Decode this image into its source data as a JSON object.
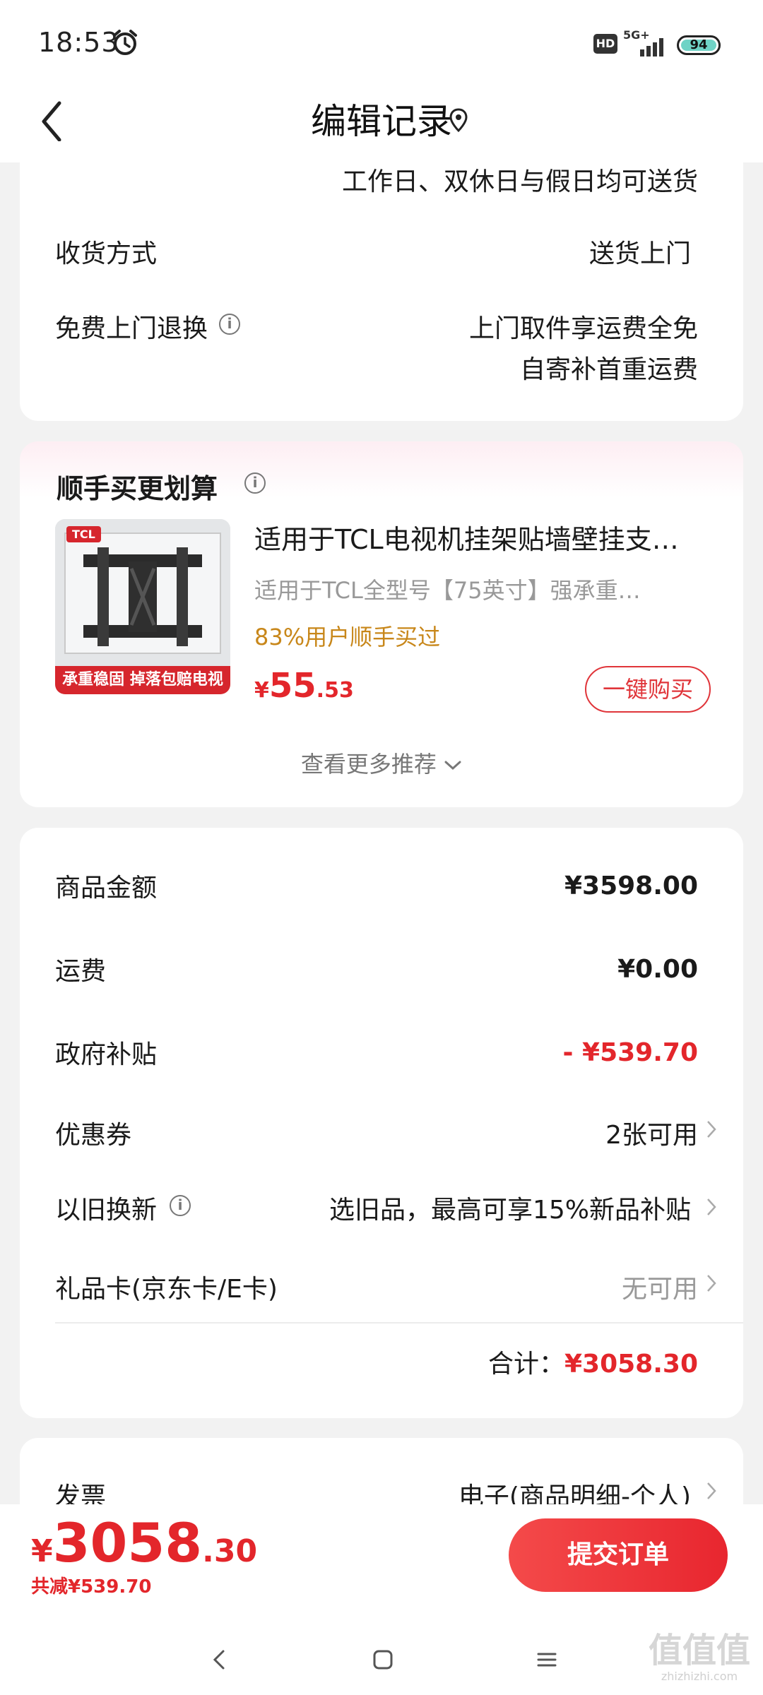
{
  "status": {
    "time": "18:53",
    "hd": "HD",
    "network": "5G+",
    "battery": "94"
  },
  "header": {
    "title": "编辑记录"
  },
  "delivery": {
    "delivery_days": "工作日、双休日与假日均可送货",
    "method_label": "收货方式",
    "method_value": "送货上门",
    "return_label": "免费上门退换",
    "return_value_1": "上门取件享运费全免",
    "return_value_2": "自寄补首重运费"
  },
  "recommend": {
    "title": "顺手买更划算",
    "product_title": "适用于TCL电视机挂架贴墙壁挂支…",
    "product_subtitle": "适用于TCL全型号【75英寸】强承重…",
    "social_proof": "83%用户顺手买过",
    "price_symbol": "¥",
    "price_int": "55",
    "price_dec": ".53",
    "buy_button": "一键购买",
    "more": "查看更多推荐",
    "thumb_tag": "TCL",
    "thumb_label": "承重稳固 掉落包赔电视"
  },
  "summary": {
    "goods_label": "商品金额",
    "goods_value": "¥3598.00",
    "shipping_label": "运费",
    "shipping_value": "¥0.00",
    "subsidy_label": "政府补贴",
    "subsidy_value": "- ¥539.70",
    "coupon_label": "优惠券",
    "coupon_value": "2张可用",
    "tradein_label": "以旧换新",
    "tradein_value": "选旧品，最高可享15%新品补贴",
    "giftcard_label": "礼品卡(京东卡/E卡)",
    "giftcard_value": "无可用",
    "total_label": "合计：",
    "total_value": "¥3058.30"
  },
  "invoice": {
    "label": "发票",
    "value": "电子(商品明细-个人)"
  },
  "bottom": {
    "symbol": "¥",
    "amount_int": "3058",
    "amount_dec": ".30",
    "savings": "共减¥539.70",
    "submit": "提交订单"
  },
  "watermark": "zhizhizhi.com",
  "colors": {
    "accent": "#e3262b",
    "background": "#f2f2f2",
    "card": "#ffffff",
    "gold": "#c8871a"
  }
}
